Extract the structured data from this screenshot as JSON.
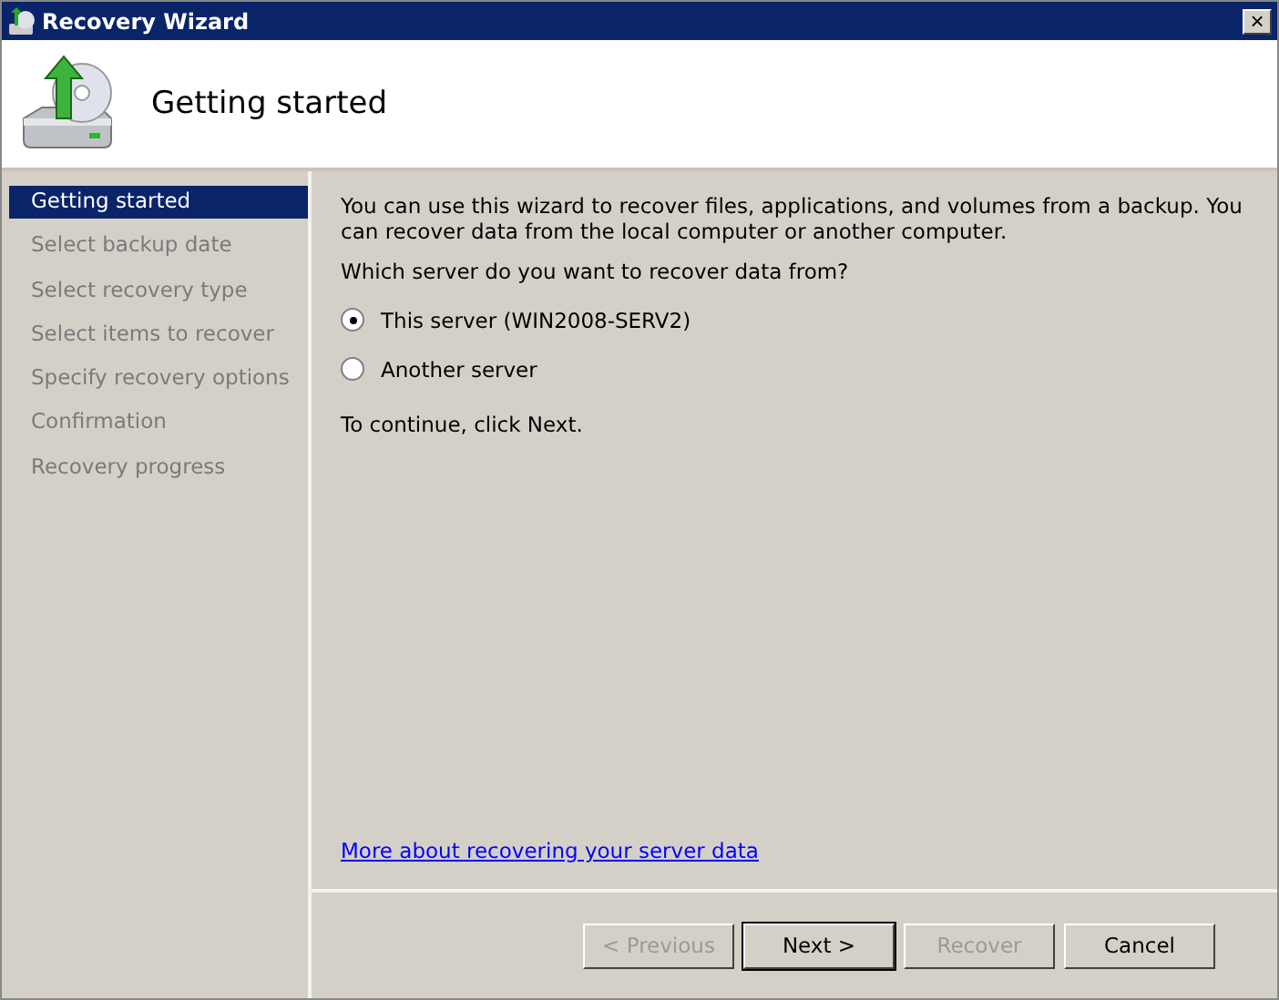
{
  "window": {
    "title": "Recovery Wizard",
    "close": "×"
  },
  "header": {
    "title": "Getting started"
  },
  "steps": [
    {
      "label": "Getting started",
      "selected": true
    },
    {
      "label": "Select backup date",
      "selected": false
    },
    {
      "label": "Select recovery type",
      "selected": false
    },
    {
      "label": "Select items to recover",
      "selected": false
    },
    {
      "label": "Specify recovery options",
      "selected": false
    },
    {
      "label": "Confirmation",
      "selected": false
    },
    {
      "label": "Recovery progress",
      "selected": false
    }
  ],
  "intro": "You can use this wizard to recover files, applications, and volumes from a backup. You can recover data from the local computer or another computer.",
  "question": "Which server do you want to recover data from?",
  "options": [
    {
      "label": "This server (WIN2008-SERV2)",
      "selected": true
    },
    {
      "label": "Another server",
      "selected": false
    }
  ],
  "hint": "To continue, click Next.",
  "link": "More about recovering your server data",
  "buttons": [
    {
      "label": "< Previous",
      "disabled": true,
      "default": false
    },
    {
      "label": "Next >",
      "disabled": false,
      "default": true
    },
    {
      "label": "Recover",
      "disabled": true,
      "default": false
    },
    {
      "label": "Cancel",
      "disabled": false,
      "default": false
    }
  ]
}
